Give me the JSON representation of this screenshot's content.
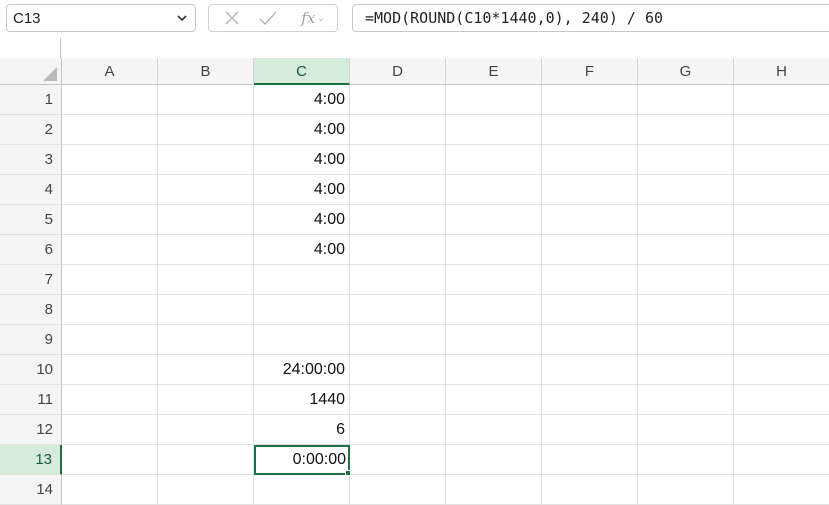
{
  "name_box": {
    "value": "C13"
  },
  "formula_bar": {
    "fx_label": "fx",
    "formula": "=MOD(ROUND(C10*1440,0), 240) / 60"
  },
  "columns": [
    "A",
    "B",
    "C",
    "D",
    "E",
    "F",
    "G",
    "H"
  ],
  "active_column": "C",
  "rows": [
    {
      "num": "1",
      "C": "4:00"
    },
    {
      "num": "2",
      "C": "4:00"
    },
    {
      "num": "3",
      "C": "4:00"
    },
    {
      "num": "4",
      "C": "4:00"
    },
    {
      "num": "5",
      "C": "4:00"
    },
    {
      "num": "6",
      "C": "4:00"
    },
    {
      "num": "7",
      "C": ""
    },
    {
      "num": "8",
      "C": ""
    },
    {
      "num": "9",
      "C": ""
    },
    {
      "num": "10",
      "C": "24:00:00"
    },
    {
      "num": "11",
      "C": "1440"
    },
    {
      "num": "12",
      "C": "6"
    },
    {
      "num": "13",
      "C": "0:00:00"
    },
    {
      "num": "14",
      "C": ""
    }
  ],
  "active_row": "13",
  "colors": {
    "accent": "#1e7145",
    "header_active_bg": "#d4ecd9"
  }
}
